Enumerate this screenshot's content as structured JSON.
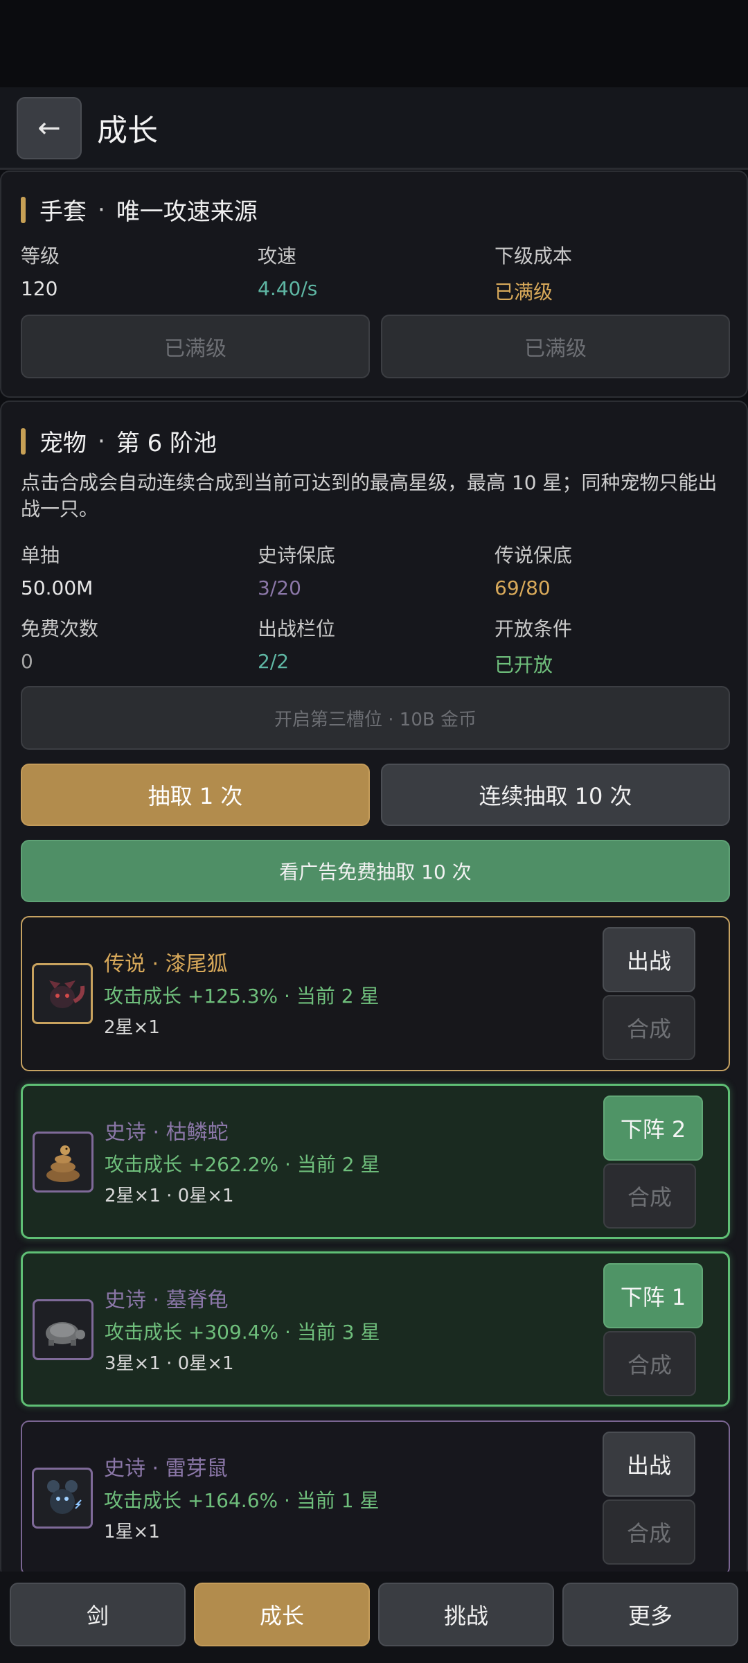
{
  "header": {
    "back_icon": "←",
    "title": "成长"
  },
  "gloves": {
    "title": "手套",
    "subtitle": "唯一攻速来源",
    "stats": [
      {
        "label": "等级",
        "value": "120"
      },
      {
        "label": "攻速",
        "value": "4.40/s"
      },
      {
        "label": "下级成本",
        "value": "已满级"
      }
    ],
    "buttons": [
      "已满级",
      "已满级"
    ]
  },
  "pets": {
    "title": "宠物",
    "subtitle": "第 6 阶池",
    "description": "点击合成会自动连续合成到当前可达到的最高星级，最高 10 星；同种宠物只能出战一只。",
    "stats": [
      {
        "label": "单抽",
        "value": "50.00M"
      },
      {
        "label": "史诗保底",
        "value": "3/20"
      },
      {
        "label": "传说保底",
        "value": "69/80"
      },
      {
        "label": "免费次数",
        "value": "0"
      },
      {
        "label": "出战栏位",
        "value": "2/2"
      },
      {
        "label": "开放条件",
        "value": "已开放"
      }
    ],
    "unlock_slot_label": "开启第三槽位 · 10B 金币",
    "draw_one_label": "抽取 1 次",
    "draw_ten_label": "连续抽取 10 次",
    "ad_draw_label": "看广告免费抽取 10 次",
    "list": [
      {
        "rarity": "传说",
        "name": "漆尾狐",
        "growth": "攻击成长 +125.3% · 当前 2 星",
        "stars": "2星×1",
        "primary_btn": "出战",
        "merge_btn": "合成",
        "icon": "fox-icon"
      },
      {
        "rarity": "史诗",
        "name": "枯鳞蛇",
        "growth": "攻击成长 +262.2% · 当前 2 星",
        "stars": "2星×1 · 0星×1",
        "primary_btn": "下阵 2",
        "merge_btn": "合成",
        "icon": "snake-icon"
      },
      {
        "rarity": "史诗",
        "name": "墓脊龟",
        "growth": "攻击成长 +309.4% · 当前 3 星",
        "stars": "3星×1 · 0星×1",
        "primary_btn": "下阵 1",
        "merge_btn": "合成",
        "icon": "turtle-icon"
      },
      {
        "rarity": "史诗",
        "name": "雷芽鼠",
        "growth": "攻击成长 +164.6% · 当前 1 星",
        "stars": "1星×1",
        "primary_btn": "出战",
        "merge_btn": "合成",
        "icon": "rat-icon"
      }
    ]
  },
  "bottom_nav": {
    "items": [
      "剑",
      "成长",
      "挑战",
      "更多"
    ],
    "active": "成长"
  },
  "colors": {
    "accent_gold": "#b28c4d",
    "legend_border": "#c6a262",
    "epic_border": "#7a6592",
    "deployed_border": "#5fbf75",
    "growth_green": "#6fbf7c"
  }
}
